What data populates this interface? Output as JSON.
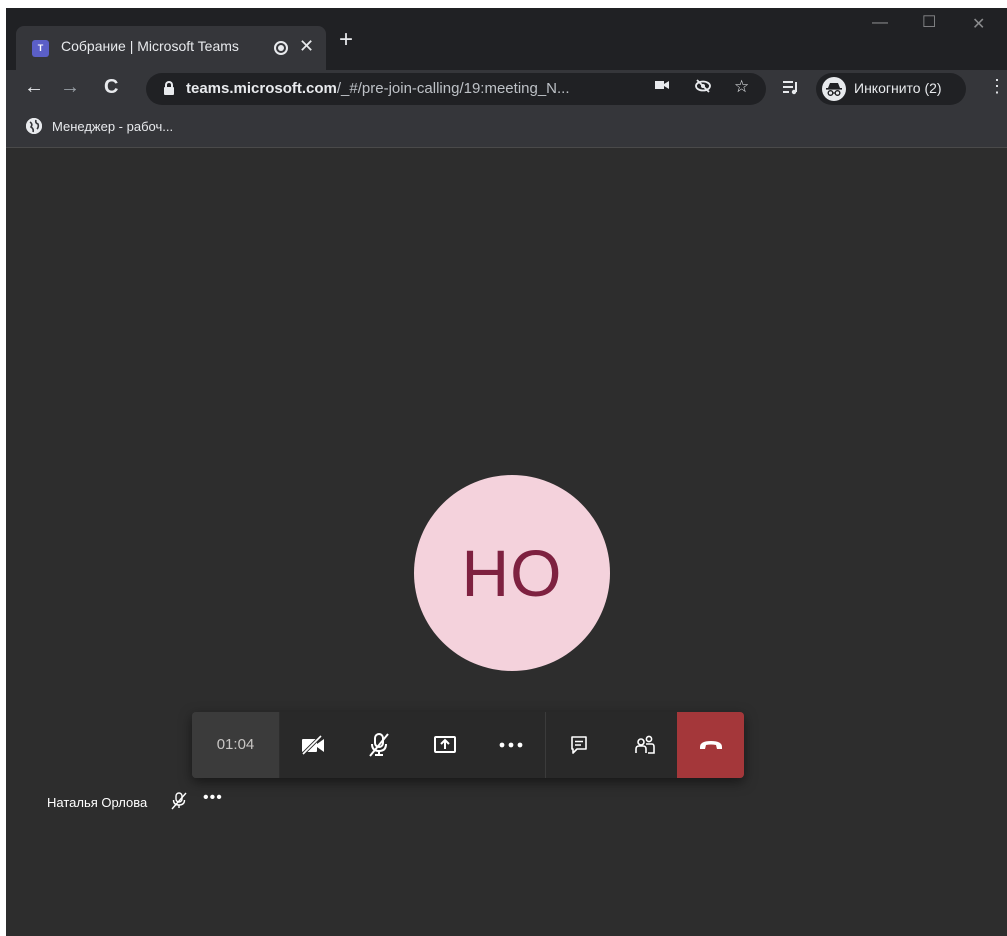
{
  "browser": {
    "tab_title": "Собрание | Microsoft Teams",
    "tab_favicon": "teams-icon",
    "url_domain": "teams.microsoft.com",
    "url_path": "/_#/pre-join-calling/19:meeting_N...",
    "profile_label": "Инкогнито (2)",
    "bookmark_label": "Менеджер - рабоч..."
  },
  "meeting": {
    "avatar_initials": "НО",
    "timer": "01:04",
    "participant_name": "Наталья Орлова",
    "more_label": "•••",
    "hangup_color": "#a4373a",
    "avatar_color": "#f4d2dc"
  }
}
